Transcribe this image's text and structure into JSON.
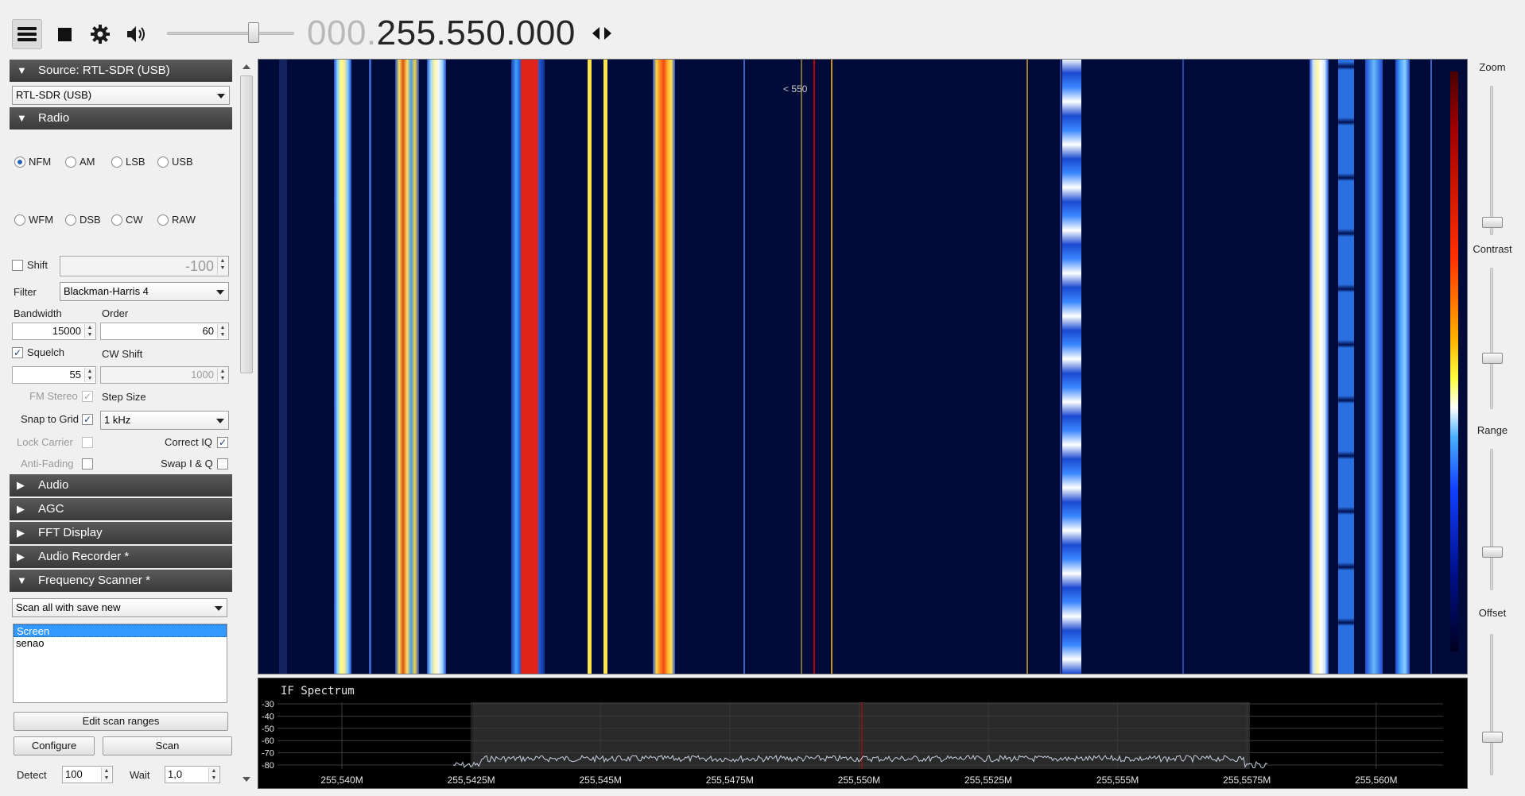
{
  "toolbar": {
    "menu_icon": "hamburger-icon",
    "stop_icon": "stop-icon",
    "settings_icon": "gear-icon",
    "volume_icon": "speaker-icon",
    "volume_level": 0.7,
    "freq_dim": "000.",
    "freq_main": "255.550.000",
    "freq_arrows_icon": "left-right-arrows-icon"
  },
  "left": {
    "source_header": "Source: RTL-SDR (USB)",
    "source_device": "RTL-SDR (USB)",
    "radio_header": "Radio",
    "modes_row1": [
      "NFM",
      "AM",
      "LSB",
      "USB"
    ],
    "modes_row2": [
      "WFM",
      "DSB",
      "CW",
      "RAW"
    ],
    "selected_mode": "NFM",
    "shift_label": "Shift",
    "shift_value": "-100",
    "filter_label": "Filter",
    "filter_value": "Blackman-Harris 4",
    "bandwidth_label": "Bandwidth",
    "bandwidth_value": "15000",
    "order_label": "Order",
    "order_value": "60",
    "squelch_label": "Squelch",
    "squelch_value": "55",
    "cw_shift_label": "CW Shift",
    "cw_shift_value": "1000",
    "fm_stereo_label": "FM Stereo",
    "step_size_label": "Step Size",
    "snap_label": "Snap to Grid",
    "step_value": "1 kHz",
    "lock_carrier_label": "Lock Carrier",
    "correct_iq_label": "Correct IQ",
    "anti_fading_label": "Anti-Fading",
    "swap_iq_label": "Swap I & Q",
    "sections": [
      "Audio",
      "AGC",
      "FFT Display",
      "Audio Recorder *"
    ],
    "scanner_header": "Frequency Scanner *",
    "scan_mode": "Scan all with save new",
    "scan_list": [
      "Screen",
      "senao"
    ],
    "edit_ranges": "Edit scan ranges",
    "configure": "Configure",
    "scan": "Scan",
    "detect_label": "Detect",
    "detect_value": "100",
    "wait_label": "Wait",
    "wait_value": "1,0",
    "check_mark": "✓"
  },
  "waterfall": {
    "cursor_label": "< 550"
  },
  "spectrum": {
    "title": "IF Spectrum",
    "y_ticks": [
      "-30",
      "-40",
      "-50",
      "-60",
      "-70",
      "-80"
    ],
    "x_ticks": [
      "255,540M",
      "255,5425M",
      "255,545M",
      "255,5475M",
      "255,550M",
      "255,5525M",
      "255,555M",
      "255,5575M",
      "255,560M"
    ]
  },
  "right": {
    "zoom": "Zoom",
    "contrast": "Contrast",
    "range": "Range",
    "offset": "Offset",
    "zoom_level": 0.95,
    "contrast_level": 0.65,
    "range_level": 0.75,
    "offset_level": 0.75
  },
  "colors": {
    "header_bg": "#3f3f3f",
    "waterfall_bg": "#000a38",
    "selected_list": "#3399ff",
    "cursor_red": "#c00000"
  }
}
